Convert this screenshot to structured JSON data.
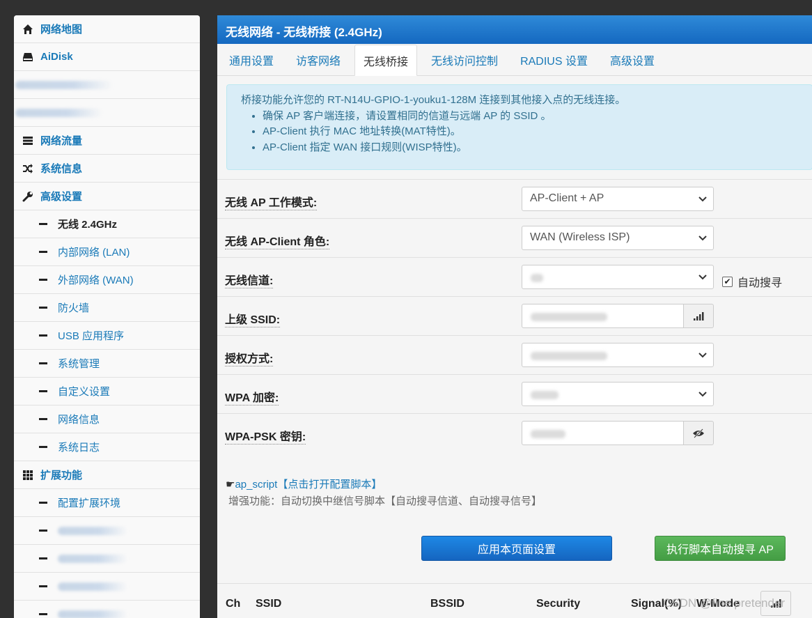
{
  "sidebar": {
    "top_items": [
      {
        "label": "网络地图",
        "icon": "home-icon"
      },
      {
        "label": "AiDisk",
        "icon": "drive-icon"
      },
      {
        "label": "",
        "icon": "blurred"
      },
      {
        "label": "",
        "icon": "blurred"
      },
      {
        "label": "网络流量",
        "icon": "server-icon"
      },
      {
        "label": "系统信息",
        "icon": "shuffle-icon"
      },
      {
        "label": "高级设置",
        "icon": "wrench-icon"
      }
    ],
    "advanced_items": [
      {
        "label": "无线 2.4GHz",
        "active": true
      },
      {
        "label": "内部网络 (LAN)"
      },
      {
        "label": "外部网络 (WAN)"
      },
      {
        "label": "防火墙"
      },
      {
        "label": "USB 应用程序"
      },
      {
        "label": "系统管理"
      },
      {
        "label": "自定义设置"
      },
      {
        "label": "网络信息"
      },
      {
        "label": "系统日志"
      }
    ],
    "extensions_label": "扩展功能",
    "extension_items": [
      {
        "label": "配置扩展环境"
      }
    ]
  },
  "main": {
    "title": "无线网络 - 无线桥接 (2.4GHz)",
    "tabs": [
      "通用设置",
      "访客网络",
      "无线桥接",
      "无线访问控制",
      "RADIUS 设置",
      "高级设置"
    ],
    "active_tab": "无线桥接",
    "info": {
      "intro": "桥接功能允许您的 RT-N14U-GPIO-1-youku1-128M 连接到其他接入点的无线连接。",
      "bullets": [
        "确保 AP 客户端连接，请设置相同的信道与远端 AP 的 SSID 。",
        "AP-Client 执行 MAC 地址转换(MAT特性)。",
        "AP-Client 指定 WAN 接口规则(WISP特性)。"
      ]
    },
    "form": {
      "ap_mode_label": "无线 AP 工作模式:",
      "ap_mode_value": "AP-Client + AP",
      "client_role_label": "无线 AP-Client 角色:",
      "client_role_value": "WAN (Wireless ISP)",
      "channel_label": "无线信道:",
      "auto_search_label": "自动搜寻",
      "auto_search_checked": true,
      "ssid_label": "上级 SSID:",
      "auth_label": "授权方式:",
      "wpa_label": "WPA 加密:",
      "psk_label": "WPA-PSK 密钥:"
    },
    "script_link": "ap_script【点击打开配置脚本】",
    "script_desc": "增强功能：自动切换中继信号脚本【自动搜寻信道、自动搜寻信号】",
    "apply_button": "应用本页面设置",
    "scan_button": "执行脚本自动搜寻 AP",
    "table_headers": [
      "Ch",
      "SSID",
      "BSSID",
      "Security",
      "Signal(%)",
      "W-Mode"
    ],
    "watermark": "CSDN @fine pretender"
  },
  "colors": {
    "header_blue": "#1468c0",
    "link_blue": "#1a7ab8",
    "info_bg": "#d9edf7",
    "apply_btn": "#1565c0",
    "scan_btn": "#449d44"
  }
}
